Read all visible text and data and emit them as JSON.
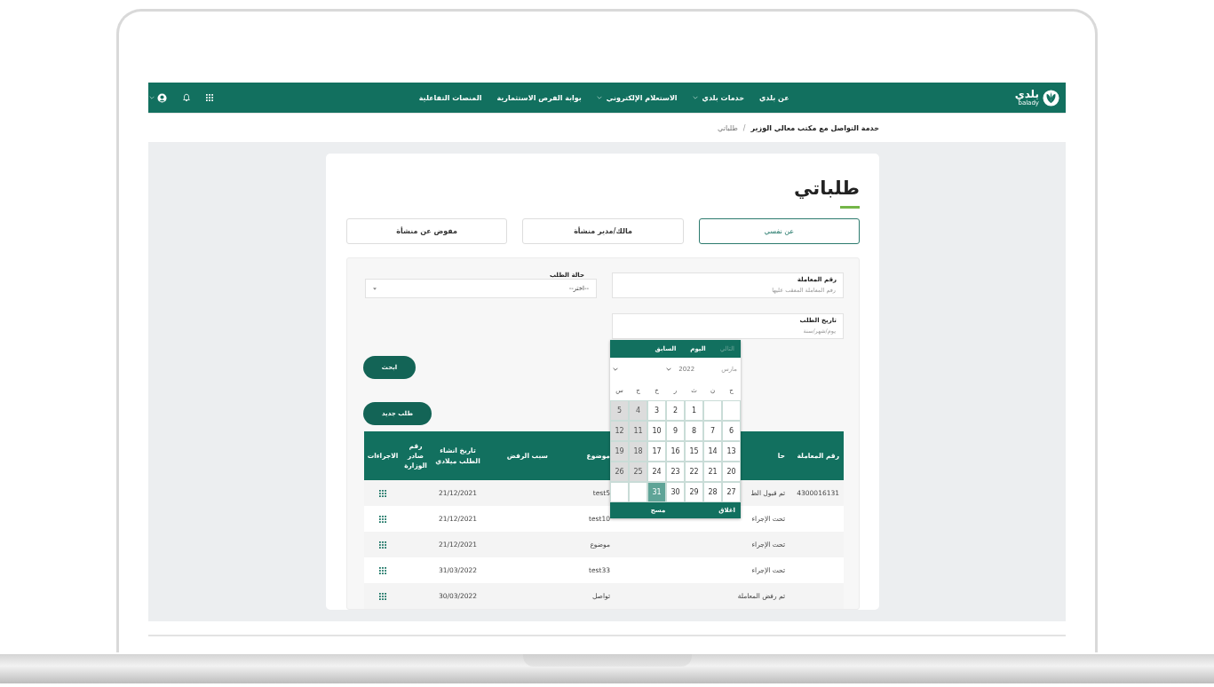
{
  "nav": {
    "logo_text": "بلدي",
    "logo_subtext": "balady",
    "links": [
      {
        "label": "عن بلدي",
        "dropdown": false
      },
      {
        "label": "خدمات بلدي",
        "dropdown": true
      },
      {
        "label": "الاستعلام الإلكتروني",
        "dropdown": true
      },
      {
        "label": "بوابة الفرص الاستثمارية",
        "dropdown": false
      },
      {
        "label": "المنصات التفاعلية",
        "dropdown": false
      }
    ]
  },
  "breadcrumb": {
    "items": [
      "خدمة التواصل مع مكتب معالي الوزير",
      "طلباتي"
    ],
    "separator": "/"
  },
  "page_title": "طلباتي",
  "tabs": [
    {
      "label": "عن نفسي",
      "selected": true
    },
    {
      "label": "مالك/مدير منشأة",
      "selected": false
    },
    {
      "label": "مفوض عن منشأة",
      "selected": false
    }
  ],
  "filters": {
    "transaction_number": {
      "label": "رقم المعاملة",
      "placeholder": "رقم المعاملة المعقب عليها"
    },
    "request_status": {
      "label": "حالة الطلب",
      "value": "--اختر--"
    },
    "request_date": {
      "label": "تاريخ الطلب",
      "placeholder": "يوم/شهر/سنة"
    }
  },
  "search_button": "ابحث",
  "new_request_button": "طلب جديد",
  "table": {
    "columns": [
      "رقم المعاملة",
      "حا",
      "موضوع",
      "سبب الرفض",
      "تاريخ انشاء الطلب ميلادي",
      "رقم صادر الوزارة",
      "الاجراءات"
    ],
    "rows": [
      [
        "4300016131",
        "تم قبول الط",
        "test5",
        null,
        "21/12/2021",
        null
      ],
      [
        null,
        "تحت الإجراء",
        "test10",
        null,
        "21/12/2021",
        null
      ],
      [
        null,
        "تحت الإجراء",
        "موضوع",
        null,
        "21/12/2021",
        null
      ],
      [
        null,
        "تحت الإجراء",
        "test33",
        null,
        "31/03/2022",
        null
      ],
      [
        null,
        "تم رفض المعاملة",
        "تواصل",
        null,
        "30/03/2022",
        null
      ]
    ]
  },
  "datepicker": {
    "next": {
      "label": "التالي",
      "disabled": true
    },
    "today": "اليوم",
    "previous": "السابق",
    "month": "مارس",
    "year": "2022",
    "weekdays": [
      "ح",
      "ن",
      "ث",
      "ر",
      "خ",
      "ج",
      "س"
    ],
    "weeks": [
      {
        "pad_before": true,
        "days": [
          {
            "day": "1",
            "disabled": false,
            "selected": false
          },
          {
            "day": "2",
            "disabled": false,
            "selected": false
          },
          {
            "day": "3",
            "disabled": false,
            "selected": false
          },
          {
            "day": "4",
            "disabled": true,
            "selected": false
          },
          {
            "day": "5",
            "disabled": true,
            "selected": false
          }
        ]
      },
      {
        "pad_before": false,
        "days": [
          {
            "day": "6",
            "disabled": false,
            "selected": false
          },
          {
            "day": "7",
            "disabled": false,
            "selected": false
          },
          {
            "day": "8",
            "disabled": false,
            "selected": false
          },
          {
            "day": "9",
            "disabled": false,
            "selected": false
          },
          {
            "day": "10",
            "disabled": false,
            "selected": false
          },
          {
            "day": "11",
            "disabled": true,
            "selected": false
          },
          {
            "day": "12",
            "disabled": true,
            "selected": false
          }
        ]
      },
      {
        "pad_before": false,
        "days": [
          {
            "day": "13",
            "disabled": false,
            "selected": false
          },
          {
            "day": "14",
            "disabled": false,
            "selected": false
          },
          {
            "day": "15",
            "disabled": false,
            "selected": false
          },
          {
            "day": "16",
            "disabled": false,
            "selected": false
          },
          {
            "day": "17",
            "disabled": false,
            "selected": false
          },
          {
            "day": "18",
            "disabled": true,
            "selected": false
          },
          {
            "day": "19",
            "disabled": true,
            "selected": false
          }
        ]
      },
      {
        "pad_before": false,
        "days": [
          {
            "day": "20",
            "disabled": false,
            "selected": false
          },
          {
            "day": "21",
            "disabled": false,
            "selected": false
          },
          {
            "day": "22",
            "disabled": false,
            "selected": false
          },
          {
            "day": "23",
            "disabled": false,
            "selected": false
          },
          {
            "day": "24",
            "disabled": false,
            "selected": false
          },
          {
            "day": "25",
            "disabled": true,
            "selected": false
          },
          {
            "day": "26",
            "disabled": true,
            "selected": false
          }
        ]
      },
      {
        "pad_before": false,
        "days": [
          {
            "day": "27",
            "disabled": false,
            "selected": false
          },
          {
            "day": "28",
            "disabled": false,
            "selected": false
          },
          {
            "day": "29",
            "disabled": false,
            "selected": false
          },
          {
            "day": "30",
            "disabled": false,
            "selected": false
          },
          {
            "day": "31",
            "disabled": false,
            "selected": true
          }
        ]
      }
    ],
    "clear": "مسح",
    "close": "اغلاق"
  }
}
